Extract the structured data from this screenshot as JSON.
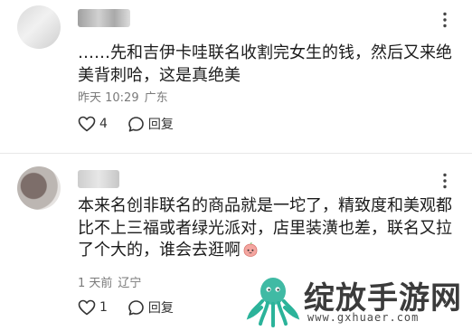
{
  "comments": [
    {
      "text": "……先和吉伊卡哇联名收割完女生的钱，然后又来绝美背刺哈，这是真绝美",
      "time": "昨天 10:29",
      "location": "广东",
      "likes": "4",
      "reply_label": "回复"
    },
    {
      "text": "本来名创非联名的商品就是一坨了，精致度和美观都比不上三福或者绿光派对，店里装潢也差，联名又拉了个大的，谁会去逛啊",
      "time": "1 天前",
      "location": "辽宁",
      "likes": "1",
      "reply_label": "回复"
    }
  ],
  "watermark": {
    "title": "绽放手游网",
    "url": "www.gxhuaer.com"
  },
  "colors": {
    "text": "#1b1b1b",
    "meta": "#7a7a7a",
    "watermark_green": "#2bb39a"
  }
}
